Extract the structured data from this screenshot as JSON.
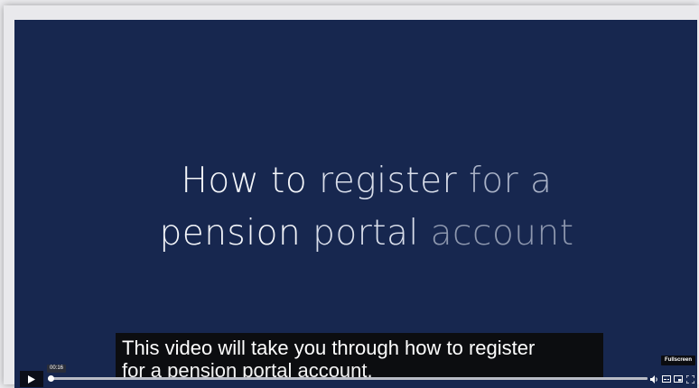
{
  "video": {
    "title_line1_a": "How to ",
    "title_line1_b": "register ",
    "title_line1_c": "for a",
    "title_line2_a": "pension ",
    "title_line2_b": "portal ",
    "title_line2_c": "account",
    "caption_line1": "This video will take you through how to register",
    "caption_line2": "for a pension portal account.",
    "background_color": "#17274f"
  },
  "controls": {
    "current_time": "00:16",
    "progress_fraction": 0.0,
    "tooltip": "Fullscreen",
    "icons": [
      "play-icon",
      "volume-icon",
      "captions-icon",
      "picture-in-picture-icon",
      "fullscreen-icon"
    ]
  }
}
